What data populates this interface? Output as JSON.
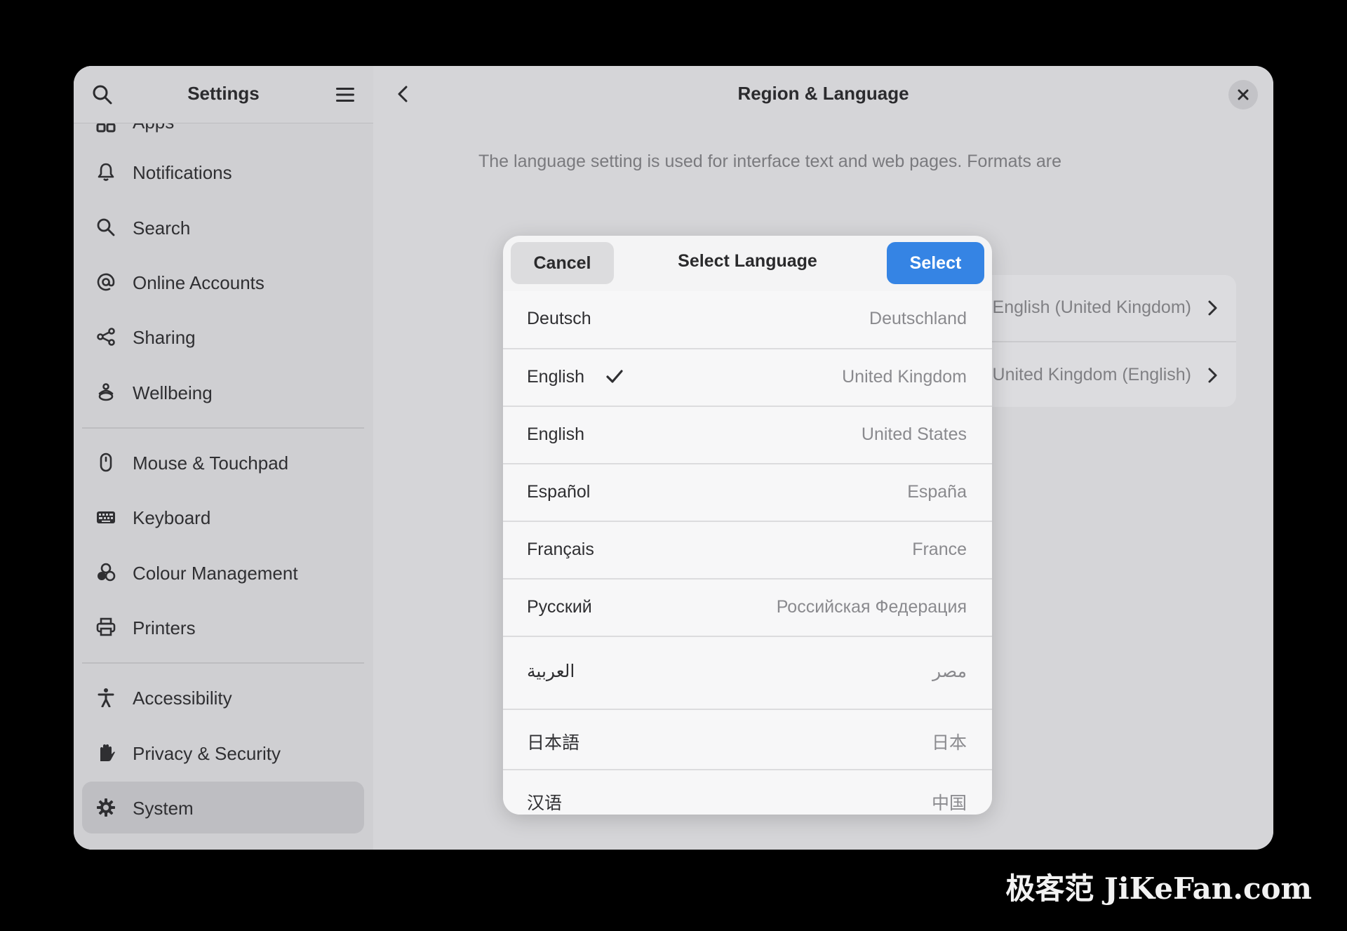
{
  "sidebar": {
    "title": "Settings",
    "partial_item": "Apps",
    "items": [
      {
        "label": "Notifications",
        "icon": "bell-icon"
      },
      {
        "label": "Search",
        "icon": "search-icon"
      },
      {
        "label": "Online Accounts",
        "icon": "at-icon"
      },
      {
        "label": "Sharing",
        "icon": "share-icon"
      },
      {
        "label": "Wellbeing",
        "icon": "wellbeing-icon"
      },
      {
        "label": "Mouse & Touchpad",
        "icon": "mouse-icon"
      },
      {
        "label": "Keyboard",
        "icon": "keyboard-icon"
      },
      {
        "label": "Colour Management",
        "icon": "colour-icon"
      },
      {
        "label": "Printers",
        "icon": "printer-icon"
      },
      {
        "label": "Accessibility",
        "icon": "accessibility-icon"
      },
      {
        "label": "Privacy & Security",
        "icon": "hand-icon"
      },
      {
        "label": "System",
        "icon": "gear-icon",
        "active": true
      }
    ]
  },
  "main": {
    "title": "Region & Language",
    "description": "The language setting is used for interface text and web pages. Formats are",
    "language_value": "English (United Kingdom)",
    "formats_value": "United Kingdom (English)"
  },
  "dialog": {
    "title": "Select Language",
    "cancel_label": "Cancel",
    "select_label": "Select",
    "languages": [
      {
        "name": "Deutsch",
        "region": "Deutschland"
      },
      {
        "name": "English",
        "region": "United Kingdom",
        "selected": true
      },
      {
        "name": "English",
        "region": "United States"
      },
      {
        "name": "Español",
        "region": "España"
      },
      {
        "name": "Français",
        "region": "France"
      },
      {
        "name": "Русский",
        "region": "Российская Федерация"
      },
      {
        "name": "العربية",
        "region": "مصر"
      },
      {
        "name": "日本語",
        "region": "日本"
      },
      {
        "name": "汉语",
        "region": "中国"
      }
    ]
  },
  "watermark": "极客范 JiKeFan.com",
  "colors": {
    "accent": "#3584e4",
    "background": "#000000",
    "window": "#d6d6d9"
  }
}
